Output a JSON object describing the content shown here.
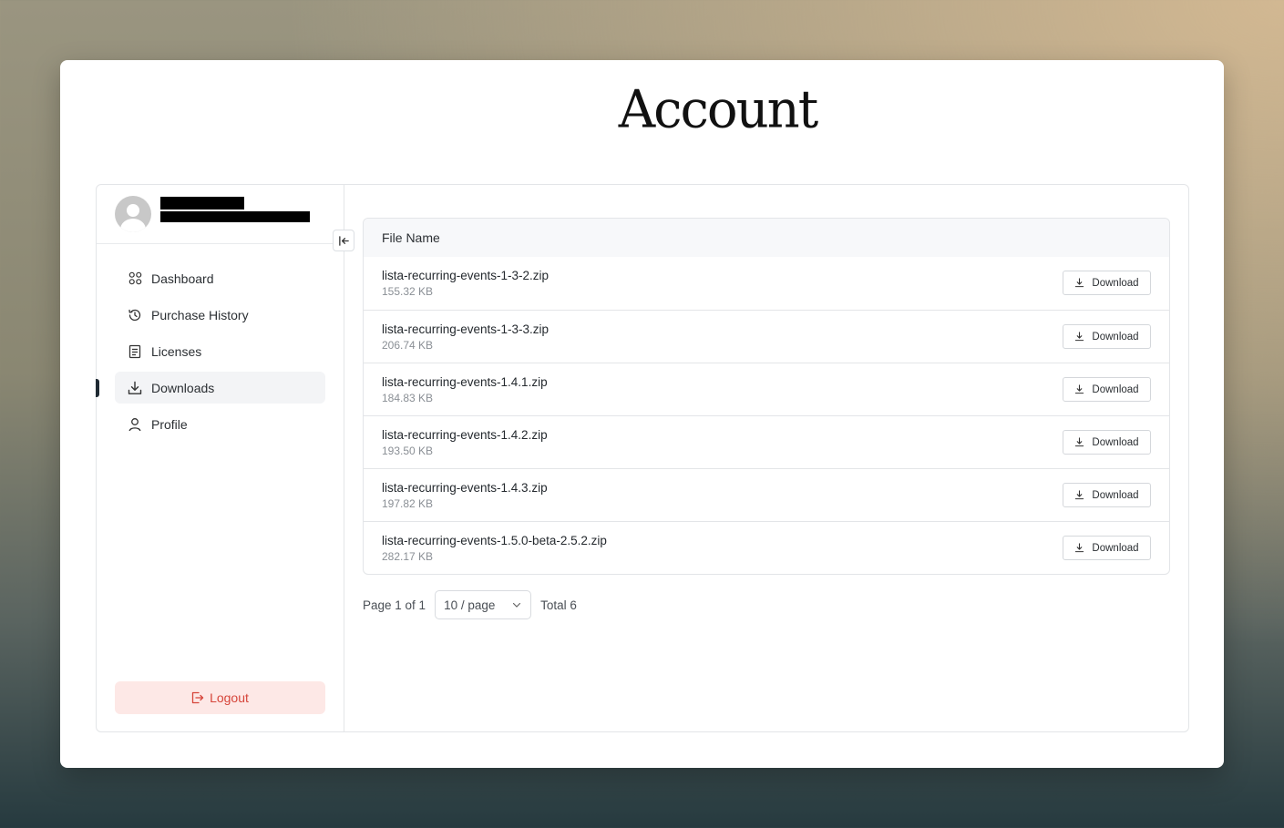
{
  "page": {
    "title": "Account"
  },
  "sidebar": {
    "items": [
      {
        "label": "Dashboard",
        "icon": "grid-icon",
        "active": false
      },
      {
        "label": "Purchase History",
        "icon": "history-icon",
        "active": false
      },
      {
        "label": "Licenses",
        "icon": "document-icon",
        "active": false
      },
      {
        "label": "Downloads",
        "icon": "download-icon",
        "active": true
      },
      {
        "label": "Profile",
        "icon": "user-icon",
        "active": false
      }
    ],
    "logout_label": "Logout"
  },
  "table": {
    "header": "File Name",
    "download_label": "Download",
    "rows": [
      {
        "name": "lista-recurring-events-1-3-2.zip",
        "size": "155.32 KB"
      },
      {
        "name": "lista-recurring-events-1-3-3.zip",
        "size": "206.74 KB"
      },
      {
        "name": "lista-recurring-events-1.4.1.zip",
        "size": "184.83 KB"
      },
      {
        "name": "lista-recurring-events-1.4.2.zip",
        "size": "193.50 KB"
      },
      {
        "name": "lista-recurring-events-1.4.3.zip",
        "size": "197.82 KB"
      },
      {
        "name": "lista-recurring-events-1.5.0-beta-2.5.2.zip",
        "size": "282.17 KB"
      }
    ]
  },
  "pagination": {
    "page_text": "Page 1 of 1",
    "per_page": "10 / page",
    "total_text": "Total 6"
  },
  "colors": {
    "logout_bg": "#fde8e6",
    "logout_text": "#d6453a",
    "active_bar": "#1f2a33"
  }
}
